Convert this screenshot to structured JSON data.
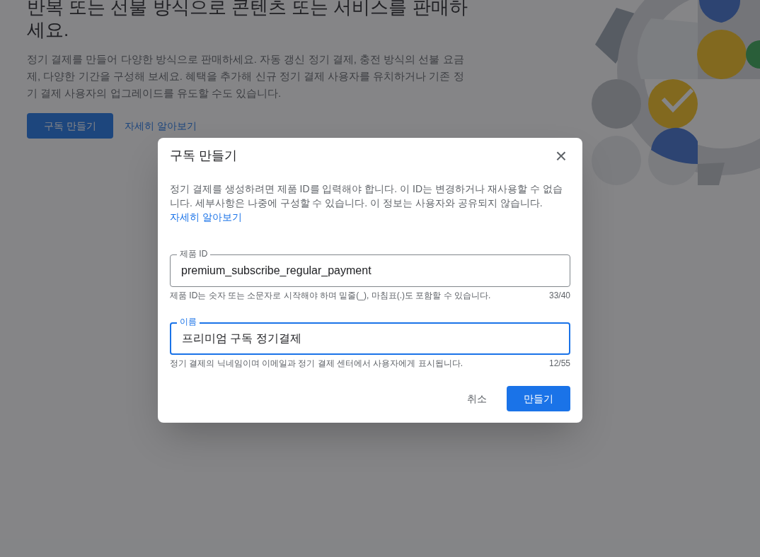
{
  "page": {
    "heading": "반복 또는 선불 방식으로 콘텐츠 또는 서비스를 판매하세요.",
    "description": "정기 결제를 만들어 다양한 방식으로 판매하세요. 자동 갱신 정기 결제, 충전 방식의 선불 요금제, 다양한 기간을 구성해 보세요. 혜택을 추가해 신규 정기 결제 사용자를 유치하거나 기존 정기 결제 사용자의 업그레이드를 유도할 수도 있습니다.",
    "button": "구독 만들기",
    "link": "자세히 알아보기"
  },
  "dialog": {
    "title": "구독 만들기",
    "close": "×",
    "description": "정기 결제를 생성하려면 제품 ID를 입력해야 합니다. 이 ID는 변경하거나 재사용할 수 없습니다. 세부사항은 나중에 구성할 수 있습니다. 이 정보는 사용자와 공유되지 않습니다.",
    "link": "자세히 알아보기",
    "fields": [
      {
        "label": "제품 ID",
        "value": "premium_subscribe_regular_payment",
        "helper": "제품 ID는 숫자 또는 소문자로 시작해야 하며 밑줄(_), 마침표(.)도 포함할 수 있습니다.",
        "counter": "33/40",
        "focused": false
      },
      {
        "label": "이름",
        "value": "프리미엄 구독 정기결제",
        "helper": "정기 결제의 닉네임이며 이메일과 정기 결제 센터에서 사용자에게 표시됩니다.",
        "counter": "12/55",
        "focused": true
      }
    ],
    "buttons": [
      {
        "label": "취소",
        "kind": "text"
      },
      {
        "label": "만들기",
        "kind": "primary"
      }
    ]
  }
}
